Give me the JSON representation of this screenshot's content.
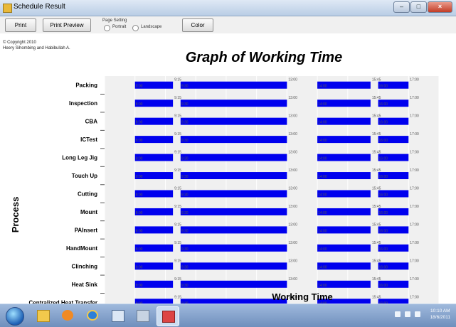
{
  "window": {
    "title": "Schedule Result"
  },
  "toolbar": {
    "print_label": "Print",
    "print_preview_label": "Print Preview",
    "page_setting_label": "Page Setting",
    "portrait_label": "Portrait",
    "landscape_label": "Landscape",
    "color_label": "Color"
  },
  "copyright": {
    "line1": "© Copyright 2010",
    "line2": "Heery Sihombing and Habibullah A."
  },
  "taskbar": {
    "time": "10:10 AM",
    "date": "18/6/2011"
  },
  "colors": {
    "bar": "#0000ee",
    "plot_bg": "#f0f0f0"
  },
  "chart_data": {
    "type": "bar",
    "orientation": "horizontal",
    "title": "Graph of Working Time",
    "xlabel": "Working Time",
    "ylabel": "Process",
    "xlim": [
      "7:00",
      "18:00"
    ],
    "xticks": [
      "0:00",
      "8:00",
      "9:00",
      "10:00",
      "11:00",
      "12:00",
      "13:00",
      "14:00",
      "15:00",
      "16:00",
      "17:00",
      "18:00"
    ],
    "categories": [
      "Packing",
      "Inspection",
      "CBA",
      "ICTest",
      "Long Leg Jig",
      "Touch Up",
      "Cutting",
      "Mount",
      "PAInsert",
      "HandMount",
      "Clinching",
      "Heat Sink",
      "Centralized Heat Transfer"
    ],
    "segments": [
      {
        "start": "8:00",
        "end": "9:15"
      },
      {
        "start": "9:30",
        "end": "13:00"
      },
      {
        "start": "14:00",
        "end": "15:45"
      },
      {
        "start": "16:00",
        "end": "17:00"
      }
    ],
    "grid": true
  }
}
